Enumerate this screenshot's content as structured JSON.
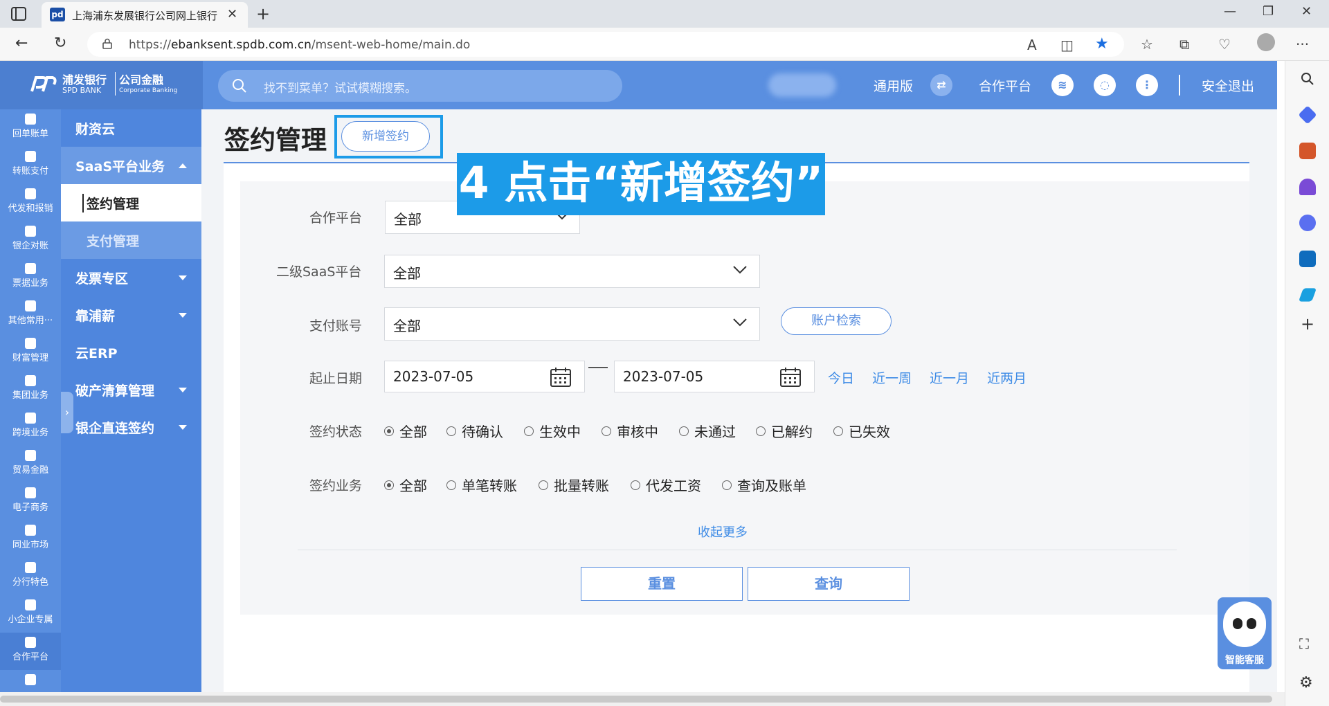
{
  "browser": {
    "tab_title": "上海浦东发展银行公司网上银行",
    "url_prefix": "https://",
    "url_host": "ebanksent.spdb.com.cn",
    "url_path": "/msent-web-home/main.do"
  },
  "header": {
    "logo_cn": "浦发银行",
    "logo_en": "SPD BANK",
    "logo_cn2": "公司金融",
    "logo_en2": "Corporate Banking",
    "search_placeholder": "找不到菜单？试试模糊搜索。",
    "version_label": "通用版",
    "partner_label": "合作平台",
    "logout_label": "安全退出"
  },
  "rail": [
    {
      "label": "回单账单",
      "icon": "receipt-icon"
    },
    {
      "label": "转账支付",
      "icon": "transfer-icon"
    },
    {
      "label": "代发和报销",
      "icon": "payroll-icon"
    },
    {
      "label": "银企对账",
      "icon": "reconcile-icon"
    },
    {
      "label": "票据业务",
      "icon": "bill-icon"
    },
    {
      "label": "其他常用···",
      "icon": "grid-icon"
    },
    {
      "label": "财富管理",
      "icon": "wealth-icon"
    },
    {
      "label": "集团业务",
      "icon": "group-icon"
    },
    {
      "label": "跨境业务",
      "icon": "crossborder-icon"
    },
    {
      "label": "贸易金融",
      "icon": "trade-icon"
    },
    {
      "label": "电子商务",
      "icon": "cart-icon"
    },
    {
      "label": "同业市场",
      "icon": "interbank-icon"
    },
    {
      "label": "分行特色",
      "icon": "branch-icon"
    },
    {
      "label": "小企业专属",
      "icon": "smallbiz-icon"
    },
    {
      "label": "合作平台",
      "icon": "layers-icon"
    }
  ],
  "menu": {
    "items": [
      {
        "label": "财资云"
      },
      {
        "label": "SaaS平台业务"
      },
      {
        "label": "签约管理"
      },
      {
        "label": "支付管理"
      },
      {
        "label": "发票专区"
      },
      {
        "label": "靠浦薪"
      },
      {
        "label": "云ERP"
      },
      {
        "label": "破产清算管理"
      },
      {
        "label": "银企直连签约"
      }
    ]
  },
  "page": {
    "title": "签约管理",
    "add_button": "新增签约",
    "annotation": "4 点击“新增签约”"
  },
  "form": {
    "partner_label": "合作平台",
    "partner_value": "全部",
    "saas_label": "二级SaaS平台",
    "saas_value": "全部",
    "account_label": "支付账号",
    "account_value": "全部",
    "account_search": "账户检索",
    "date_label": "起止日期",
    "date_start": "2023-07-05",
    "date_end": "2023-07-05",
    "quick_dates": [
      "今日",
      "近一周",
      "近一月",
      "近两月"
    ],
    "status_label": "签约状态",
    "status_options": [
      "全部",
      "待确认",
      "生效中",
      "审核中",
      "未通过",
      "已解约",
      "已失效"
    ],
    "business_label": "签约业务",
    "business_options": [
      "全部",
      "单笔转账",
      "批量转账",
      "代发工资",
      "查询及账单"
    ],
    "collapse_more": "收起更多",
    "reset_button": "重置",
    "query_button": "查询"
  },
  "assistant": {
    "label": "智能客服"
  },
  "colors": {
    "primary": "#5a8fe0",
    "menu": "#4f86dd",
    "highlight": "#1c9be8",
    "link": "#3d8be6"
  }
}
